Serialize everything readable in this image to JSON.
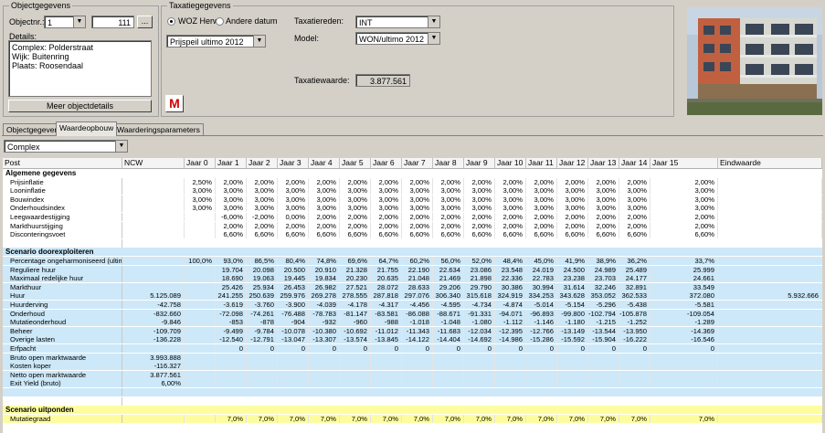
{
  "objectgegevens": {
    "group_title": "Objectgegevens",
    "objectnr_label": "Objectnr.:",
    "objectnr_value": "1",
    "objectnr_code": "111",
    "browse_label": "...",
    "details_label": "Details:",
    "details_lines": [
      "Complex: Polderstraat",
      "Wijk: Buitenring",
      "Plaats: Roosendaal"
    ],
    "more_button": "Meer objectdetails",
    "m_button": "M"
  },
  "taxatie": {
    "group_title": "Taxatiegegevens",
    "radio_woz": "WOZ Herw.",
    "radio_andere": "Andere datum",
    "prijspeil_value": "Prijspeil ultimo 2012",
    "taxatiereden_label": "Taxatiereden:",
    "taxatiereden_value": "INT",
    "model_label": "Model:",
    "model_value": "WON/ultimo 2012",
    "taxatiewaarde_label": "Taxatiewaarde:",
    "taxatiewaarde_value": "3.877.561"
  },
  "tabs": [
    "Objectgegevens",
    "Waardeopbouw",
    "Waarderingsparameters"
  ],
  "active_tab": 1,
  "complex_select": "Complex",
  "colors": {
    "section_blue": "#cde8f8",
    "section_yellow": "#fdfda0",
    "accent_red": "#d00000"
  },
  "grid": {
    "headers": [
      "Post",
      "NCW",
      "Jaar 0",
      "Jaar 1",
      "Jaar 2",
      "Jaar 3",
      "Jaar 4",
      "Jaar 5",
      "Jaar 6",
      "Jaar 7",
      "Jaar 8",
      "Jaar 9",
      "Jaar 10",
      "Jaar 11",
      "Jaar 12",
      "Jaar 13",
      "Jaar 14",
      "Jaar 15",
      "Eindwaarde"
    ],
    "rows": [
      {
        "type": "section",
        "bg": "white",
        "cells": [
          "Algemene gegevens"
        ]
      },
      {
        "bg": "white",
        "cells": [
          "Prijsinflatie",
          "",
          "2,50%",
          "2,00%",
          "2,00%",
          "2,00%",
          "2,00%",
          "2,00%",
          "2,00%",
          "2,00%",
          "2,00%",
          "2,00%",
          "2,00%",
          "2,00%",
          "2,00%",
          "2,00%",
          "2,00%",
          "2,00%",
          ""
        ]
      },
      {
        "bg": "white",
        "cells": [
          "Looninflatie",
          "",
          "3,00%",
          "3,00%",
          "3,00%",
          "3,00%",
          "3,00%",
          "3,00%",
          "3,00%",
          "3,00%",
          "3,00%",
          "3,00%",
          "3,00%",
          "3,00%",
          "3,00%",
          "3,00%",
          "3,00%",
          "3,00%",
          ""
        ]
      },
      {
        "bg": "white",
        "cells": [
          "Bouwindex",
          "",
          "3,00%",
          "3,00%",
          "3,00%",
          "3,00%",
          "3,00%",
          "3,00%",
          "3,00%",
          "3,00%",
          "3,00%",
          "3,00%",
          "3,00%",
          "3,00%",
          "3,00%",
          "3,00%",
          "3,00%",
          "3,00%",
          ""
        ]
      },
      {
        "bg": "white",
        "cells": [
          "Onderhoudsindex",
          "",
          "3,00%",
          "3,00%",
          "3,00%",
          "3,00%",
          "3,00%",
          "3,00%",
          "3,00%",
          "3,00%",
          "3,00%",
          "3,00%",
          "3,00%",
          "3,00%",
          "3,00%",
          "3,00%",
          "3,00%",
          "3,00%",
          ""
        ]
      },
      {
        "bg": "white",
        "cells": [
          "Leegwaardestijging",
          "",
          "",
          "-6,00%",
          "-2,00%",
          "0,00%",
          "2,00%",
          "2,00%",
          "2,00%",
          "2,00%",
          "2,00%",
          "2,00%",
          "2,00%",
          "2,00%",
          "2,00%",
          "2,00%",
          "2,00%",
          "2,00%",
          ""
        ]
      },
      {
        "bg": "white",
        "cells": [
          "Markthuurstijging",
          "",
          "",
          "2,00%",
          "2,00%",
          "2,00%",
          "2,00%",
          "2,00%",
          "2,00%",
          "2,00%",
          "2,00%",
          "2,00%",
          "2,00%",
          "2,00%",
          "2,00%",
          "2,00%",
          "2,00%",
          "2,00%",
          ""
        ]
      },
      {
        "bg": "white",
        "cells": [
          "Disconteringsvoet",
          "",
          "",
          "6,60%",
          "6,60%",
          "6,60%",
          "6,60%",
          "6,60%",
          "6,60%",
          "6,60%",
          "6,60%",
          "6,60%",
          "6,60%",
          "6,60%",
          "6,60%",
          "6,60%",
          "6,60%",
          "6,60%",
          ""
        ]
      },
      {
        "type": "blank",
        "bg": "white",
        "cells": [
          ""
        ]
      },
      {
        "type": "section",
        "bg": "blue",
        "cells": [
          "Scenario doorexploiteren"
        ]
      },
      {
        "bg": "blue",
        "cells": [
          "Percentage ongeharmoniseerd (ultimo)",
          "",
          "100,0%",
          "93,0%",
          "86,5%",
          "80,4%",
          "74,8%",
          "69,6%",
          "64,7%",
          "60,2%",
          "56,0%",
          "52,0%",
          "48,4%",
          "45,0%",
          "41,9%",
          "38,9%",
          "36,2%",
          "33,7%",
          ""
        ]
      },
      {
        "bg": "blue",
        "cells": [
          "Reguliere huur",
          "",
          "",
          "19.704",
          "20.098",
          "20.500",
          "20.910",
          "21.328",
          "21.755",
          "22.190",
          "22.634",
          "23.086",
          "23.548",
          "24.019",
          "24.500",
          "24.989",
          "25.489",
          "25.999",
          ""
        ]
      },
      {
        "bg": "blue",
        "cells": [
          "Maximaal redelijke huur",
          "",
          "",
          "18.690",
          "19.063",
          "19.445",
          "19.834",
          "20.230",
          "20.635",
          "21.048",
          "21.469",
          "21.898",
          "22.336",
          "22.783",
          "23.238",
          "23.703",
          "24.177",
          "24.661",
          ""
        ]
      },
      {
        "bg": "blue",
        "cells": [
          "Markthuur",
          "",
          "",
          "25.426",
          "25.934",
          "26.453",
          "26.982",
          "27.521",
          "28.072",
          "28.633",
          "29.206",
          "29.790",
          "30.386",
          "30.994",
          "31.614",
          "32.246",
          "32.891",
          "33.549",
          ""
        ]
      },
      {
        "bg": "blue",
        "cells": [
          "Huur",
          "5.125.089",
          "",
          "241.255",
          "250.639",
          "259.976",
          "269.278",
          "278.555",
          "287.818",
          "297.076",
          "306.340",
          "315.618",
          "324.919",
          "334.253",
          "343.628",
          "353.052",
          "362.533",
          "372.080",
          "5.932.666"
        ]
      },
      {
        "bg": "blue",
        "cells": [
          "Huurderving",
          "-42.758",
          "",
          "-3.619",
          "-3.760",
          "-3.900",
          "-4.039",
          "-4.178",
          "-4.317",
          "-4.456",
          "-4.595",
          "-4.734",
          "-4.874",
          "-5.014",
          "-5.154",
          "-5.296",
          "-5.438",
          "-5.581",
          ""
        ]
      },
      {
        "bg": "blue",
        "cells": [
          "Onderhoud",
          "-832.660",
          "",
          "-72.098",
          "-74.261",
          "-76.488",
          "-78.783",
          "-81.147",
          "-83.581",
          "-86.088",
          "-88.671",
          "-91.331",
          "-94.071",
          "-96.893",
          "-99.800",
          "-102.794",
          "-105.878",
          "-109.054",
          ""
        ]
      },
      {
        "bg": "blue",
        "cells": [
          "Mutatieonderhoud",
          "-9.846",
          "",
          "-853",
          "-878",
          "-904",
          "-932",
          "-960",
          "-988",
          "-1.018",
          "-1.048",
          "-1.080",
          "-1.112",
          "-1.146",
          "-1.180",
          "-1.215",
          "-1.252",
          "-1.289",
          ""
        ]
      },
      {
        "bg": "blue",
        "cells": [
          "Beheer",
          "-109.709",
          "",
          "-9.499",
          "-9.784",
          "-10.078",
          "-10.380",
          "-10.692",
          "-11.012",
          "-11.343",
          "-11.683",
          "-12.034",
          "-12.395",
          "-12.766",
          "-13.149",
          "-13.544",
          "-13.950",
          "-14.369",
          ""
        ]
      },
      {
        "bg": "blue",
        "cells": [
          "Overige lasten",
          "-136.228",
          "",
          "-12.540",
          "-12.791",
          "-13.047",
          "-13.307",
          "-13.574",
          "-13.845",
          "-14.122",
          "-14.404",
          "-14.692",
          "-14.986",
          "-15.286",
          "-15.592",
          "-15.904",
          "-16.222",
          "-16.546",
          ""
        ]
      },
      {
        "bg": "blue",
        "cells": [
          "Erfpacht",
          "",
          "",
          "0",
          "0",
          "0",
          "0",
          "0",
          "0",
          "0",
          "0",
          "0",
          "0",
          "0",
          "0",
          "0",
          "0",
          "0",
          ""
        ]
      },
      {
        "bg": "blue",
        "cells": [
          "Bruto open marktwaarde",
          "3.993.888",
          "",
          "",
          "",
          "",
          "",
          "",
          "",
          "",
          "",
          "",
          "",
          "",
          "",
          "",
          "",
          "",
          ""
        ]
      },
      {
        "bg": "blue",
        "cells": [
          "Kosten koper",
          "-116.327",
          "",
          "",
          "",
          "",
          "",
          "",
          "",
          "",
          "",
          "",
          "",
          "",
          "",
          "",
          "",
          "",
          ""
        ]
      },
      {
        "bg": "blue",
        "cells": [
          "Netto open marktwaarde",
          "3.877.561",
          "",
          "",
          "",
          "",
          "",
          "",
          "",
          "",
          "",
          "",
          "",
          "",
          "",
          "",
          "",
          "",
          ""
        ]
      },
      {
        "bg": "blue",
        "cells": [
          "Exit Yield (bruto)",
          "6,00%",
          "",
          "",
          "",
          "",
          "",
          "",
          "",
          "",
          "",
          "",
          "",
          "",
          "",
          "",
          "",
          "",
          ""
        ]
      },
      {
        "type": "blank",
        "bg": "blue",
        "cells": [
          ""
        ]
      },
      {
        "type": "blank",
        "bg": "white",
        "cells": [
          ""
        ]
      },
      {
        "type": "section",
        "bg": "yellow",
        "cells": [
          "Scenario uitponden"
        ]
      },
      {
        "bg": "yellow",
        "cells": [
          "Mutatiegraad",
          "",
          "",
          "7,0%",
          "7,0%",
          "7,0%",
          "7,0%",
          "7,0%",
          "7,0%",
          "7,0%",
          "7,0%",
          "7,0%",
          "7,0%",
          "7,0%",
          "7,0%",
          "7,0%",
          "7,0%",
          "7,0%",
          ""
        ]
      }
    ]
  }
}
